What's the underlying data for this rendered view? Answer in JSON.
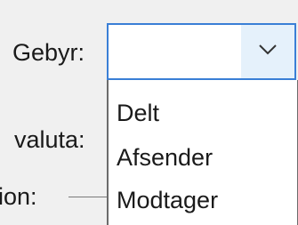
{
  "labels": {
    "fee": "Gebyr:",
    "currency": "valuta:",
    "partial": "ion:"
  },
  "fee_combo": {
    "selected_value": "",
    "arrow_icon": "chevron-down-icon",
    "accent_color": "#3a7fd6",
    "options": [
      "Delt",
      "Afsender",
      "Modtager"
    ]
  }
}
